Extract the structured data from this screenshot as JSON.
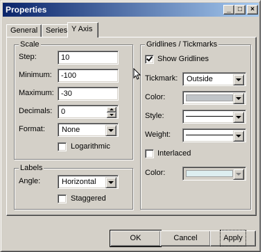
{
  "window": {
    "title": "Properties"
  },
  "titlebar_buttons": {
    "minimize": "_",
    "maximize": "□",
    "close": "×"
  },
  "tabs": [
    {
      "label": "General"
    },
    {
      "label": "Series"
    },
    {
      "label": "Y Axis"
    }
  ],
  "scale": {
    "title": "Scale",
    "step_label": "Step:",
    "step_value": "10",
    "minimum_label": "Minimum:",
    "minimum_value": "-100",
    "maximum_label": "Maximum:",
    "maximum_value": "-30",
    "decimals_label": "Decimals:",
    "decimals_value": "0",
    "format_label": "Format:",
    "format_value": "None",
    "logarithmic_label": "Logarithmic",
    "logarithmic_checked": false
  },
  "labels": {
    "title": "Labels",
    "angle_label": "Angle:",
    "angle_value": "Horizontal",
    "staggered_label": "Staggered",
    "staggered_checked": false
  },
  "gridlines": {
    "title": "Gridlines / Tickmarks",
    "show_gridlines_label": "Show Gridlines",
    "show_gridlines_checked": true,
    "tickmark_label": "Tickmark:",
    "tickmark_value": "Outside",
    "color_label": "Color:",
    "color_swatch": "#c0c4c8",
    "style_label": "Style:",
    "weight_label": "Weight:",
    "interlaced_label": "Interlaced",
    "interlaced_checked": false,
    "interlaced_color_label": "Color:",
    "interlaced_color_swatch": "#ddeef0"
  },
  "buttons": {
    "ok": "OK",
    "cancel": "Cancel",
    "apply": "Apply"
  },
  "colors": {
    "title_start": "#0a246a",
    "title_end": "#a6caf0",
    "face": "#d4d0c8"
  }
}
